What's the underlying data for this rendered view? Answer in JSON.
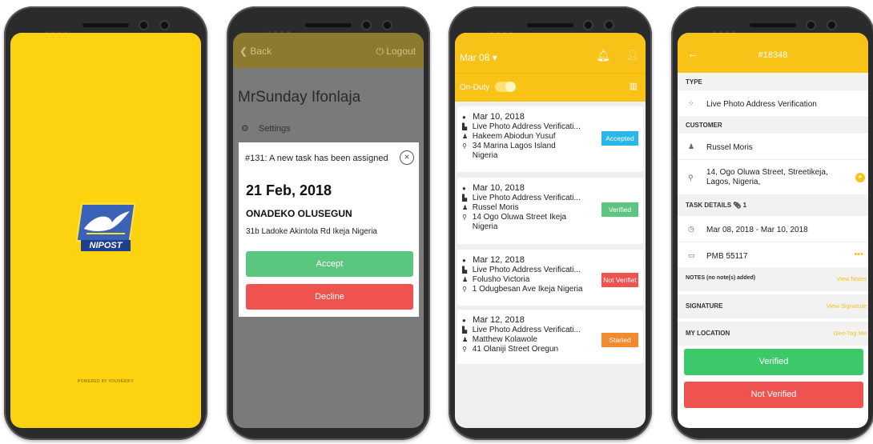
{
  "splash": {
    "logo_text": "NIPOST",
    "powered_by": "POWERED BY YOUVERIFY"
  },
  "modal_screen": {
    "back_label": "Back",
    "logout_label": "Logout",
    "user_name": "MrSunday Ifonlaja",
    "settings_label": "Settings",
    "notification": "#131: A new task has been assigned",
    "date": "21 Feb, 2018",
    "customer": "ONADEKO OLUSEGUN",
    "address": "31b Ladoke Akintola Rd Ikeja Nigeria",
    "accept_label": "Accept",
    "decline_label": "Decline"
  },
  "list_screen": {
    "date_selector": "Mar 08",
    "duty_label": "On-Duty",
    "tasks": [
      {
        "date": "Mar 10, 2018",
        "type": "Live Photo Address Verificati...",
        "name": "Hakeem Abiodun Yusuf",
        "address_line1": "34 Marina Lagos Island",
        "address_line2": "Nigeria",
        "status": "Accepted",
        "status_color": "#29b6e8"
      },
      {
        "date": "Mar 10, 2018",
        "type": "Live Photo Address Verificati...",
        "name": "Russel Moris",
        "address_line1": "14 Ogo Oluwa Street Ikeja",
        "address_line2": "Nigeria",
        "status": "Verified",
        "status_color": "#5bc680"
      },
      {
        "date": "Mar 12, 2018",
        "type": "Live Photo Address Verificati...",
        "name": "Folusho Victoria",
        "address_line1": "1 Odugbesan Ave Ikeja Nigeria",
        "address_line2": "",
        "status": "Not Verifiet",
        "status_color": "#ef5350"
      },
      {
        "date": "Mar 12, 2018",
        "type": "Live Photo Address Verificati...",
        "name": "Matthew Kolawole",
        "address_line1": "41 Olaniji Street Oregun",
        "address_line2": "",
        "status": "Started",
        "status_color": "#f28b30"
      }
    ]
  },
  "detail_screen": {
    "task_id": "#18348",
    "type_header": "TYPE",
    "type_value": "Live Photo Address Verification",
    "customer_header": "CUSTOMER",
    "customer_name": "Russel Moris",
    "customer_address": "14, Ogo Oluwa Street, Streetikeja,",
    "customer_address2": "Lagos, Nigeria,",
    "task_details_header": "TASK DETAILS",
    "attachment_count": "1",
    "date_range": "Mar 08, 2018 - Mar 10, 2018",
    "pmb": "PMB 55117",
    "notes_header": "NOTES (no note(s) added)",
    "view_notes": "View Notes",
    "signature_header": "SIGNATURE",
    "view_signature": "View Signature",
    "location_header": "MY LOCATION",
    "geo_tag": "Geo-Tag Me",
    "verified_label": "Verified",
    "not_verified_label": "Not Verified"
  },
  "colors": {
    "brand_yellow": "#f9c217",
    "green": "#5bc680",
    "red": "#ef5350"
  }
}
